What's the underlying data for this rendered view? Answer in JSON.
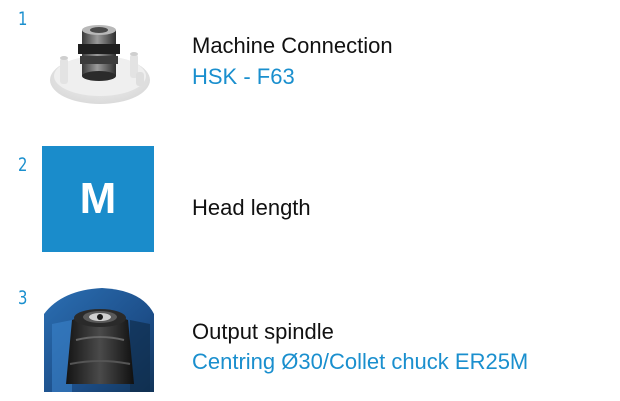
{
  "colors": {
    "accent": "#1a8ccb",
    "value_text": "#1a8fce",
    "label_text": "#111111"
  },
  "items": [
    {
      "number": "1",
      "icon": "machine-connection-image",
      "label": "Machine Connection",
      "value": "HSK - F63"
    },
    {
      "number": "2",
      "icon": "head-length-badge",
      "badge_letter": "M",
      "label": "Head length",
      "value": ""
    },
    {
      "number": "3",
      "icon": "output-spindle-image",
      "label": "Output spindle",
      "value": "Centring Ø30/Collet chuck ER25M"
    }
  ]
}
